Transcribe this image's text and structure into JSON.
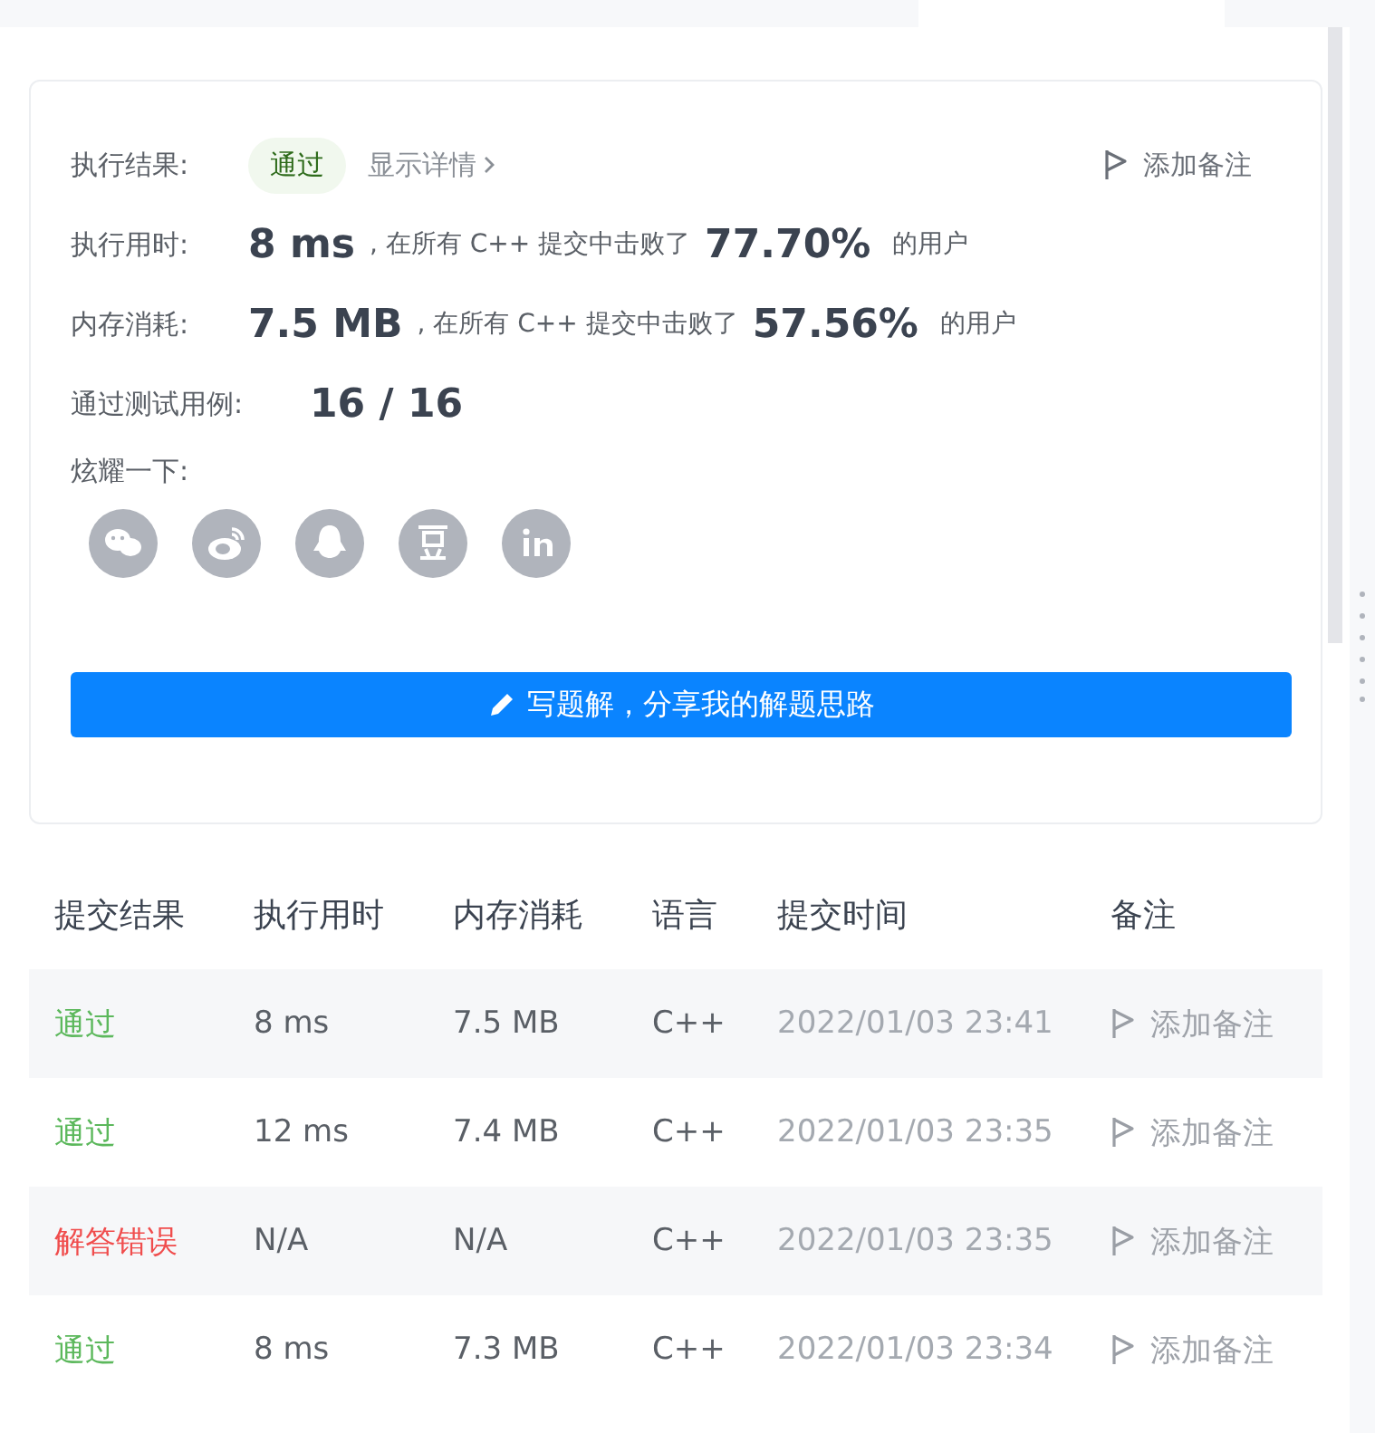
{
  "result": {
    "label": "执行结果:",
    "status": "通过",
    "details_link": "显示详情",
    "add_note": "添加备注"
  },
  "metrics": [
    {
      "label": "执行用时:",
      "value": "8 ms",
      "text": ", 在所有 C++ 提交中击败了",
      "percent": "77.70%",
      "suffix": "的用户"
    },
    {
      "label": "内存消耗:",
      "value": "7.5 MB",
      "text": ", 在所有 C++ 提交中击败了",
      "percent": "57.56%",
      "suffix": "的用户"
    }
  ],
  "tests": {
    "label": "通过测试用例:",
    "value": "16 / 16"
  },
  "share": {
    "label": "炫耀一下:",
    "icons": [
      {
        "kind": "wechat"
      },
      {
        "kind": "weibo"
      },
      {
        "kind": "qq"
      },
      {
        "kind": "douban"
      },
      {
        "kind": "linkedin"
      }
    ]
  },
  "write_button": "写题解，分享我的解题思路",
  "table": {
    "columns": [
      "提交结果",
      "执行用时",
      "内存消耗",
      "语言",
      "提交时间",
      "备注"
    ],
    "rows": [
      {
        "result": "通过",
        "color": "#5cb85c",
        "time": "8 ms",
        "memory": "7.5 MB",
        "language": "C++",
        "submitted": "2022/01/03 23:41",
        "note": "添加备注"
      },
      {
        "result": "通过",
        "color": "#5cb85c",
        "time": "12 ms",
        "memory": "7.4 MB",
        "language": "C++",
        "submitted": "2022/01/03 23:35",
        "note": "添加备注"
      },
      {
        "result": "解答错误",
        "color": "#f04d4d",
        "time": "N/A",
        "memory": "N/A",
        "language": "C++",
        "submitted": "2022/01/03 23:35",
        "note": "添加备注"
      },
      {
        "result": "通过",
        "color": "#5cb85c",
        "time": "8 ms",
        "memory": "7.3 MB",
        "language": "C++",
        "submitted": "2022/01/03 23:34",
        "note": "添加备注"
      }
    ]
  }
}
